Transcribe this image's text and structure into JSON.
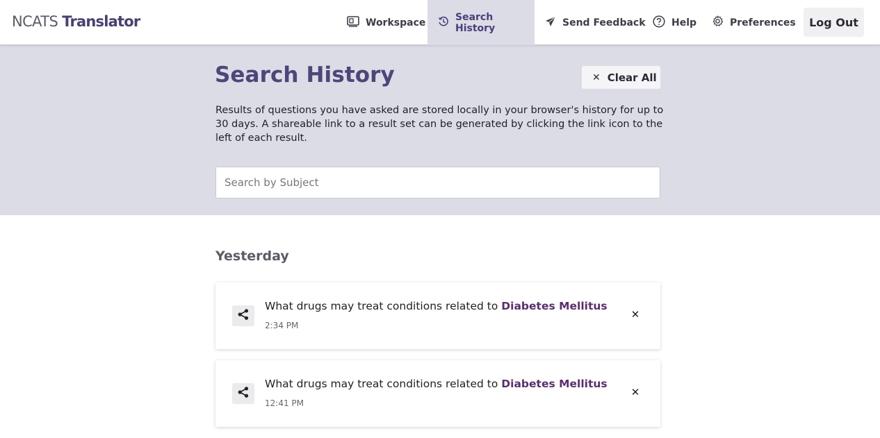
{
  "app": {
    "logo_prefix": "NCATS",
    "logo_name": "Translator"
  },
  "nav": {
    "workspace": {
      "label": "Workspace",
      "icon": "workspace-icon"
    },
    "search_history": {
      "label": "Search History",
      "icon": "history-icon",
      "active": true
    },
    "send_feedback": {
      "label": "Send Feedback",
      "icon": "send-icon"
    },
    "help": {
      "label": "Help",
      "icon": "help-icon"
    },
    "preferences": {
      "label": "Preferences",
      "icon": "gear-icon"
    },
    "logout": {
      "label": "Log Out"
    }
  },
  "page": {
    "title": "Search History",
    "clear_all_label": "Clear All",
    "description": "Results of questions you have asked are stored locally in your browser's history for up to 30 days. A shareable link to a result set can be generated by clicking the link icon to the left of each result.",
    "search_placeholder": "Search by Subject",
    "search_value": ""
  },
  "history": {
    "group_label": "Yesterday",
    "items": [
      {
        "question_prefix": "What drugs may treat conditions related to",
        "subject": "Diabetes Mellitus",
        "time": "2:34 PM"
      },
      {
        "question_prefix": "What drugs may treat conditions related to",
        "subject": "Diabetes Mellitus",
        "time": "12:41 PM"
      }
    ]
  },
  "colors": {
    "brand": "#4a4070",
    "banner_bg": "#dcdce6",
    "subject_link": "#5a2f6d",
    "title": "#4d467a"
  }
}
